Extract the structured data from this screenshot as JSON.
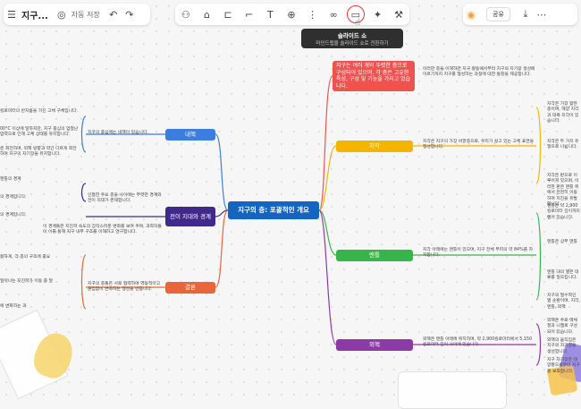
{
  "app": {
    "title": "지구...",
    "save_status": "자동 저장",
    "share_label": "공유"
  },
  "toolbar": {
    "center_icons": [
      "sticker-icon",
      "clip-icon",
      "subtopic-icon",
      "format-painter-icon",
      "text-icon",
      "insert-icon",
      "branch-icon",
      "link-icon",
      "slideshow-icon",
      "sparkle-icon",
      "magic-wand-icon"
    ]
  },
  "tooltip": {
    "title": "슬라이드 쇼",
    "desc": "마인드맵을 슬라이드 쇼로 전환하기"
  },
  "mindmap": {
    "root": "지구의 층: 포괄적인 개요",
    "left_nodes": {
      "inner": "내핵",
      "transition": "전이 지대와 경계",
      "crust": "결론"
    },
    "right_nodes": {
      "summary": "지구는 여러 개의 뚜렷한 층으로 구성되어 있으며, 각 층은 고유한 특성, 구성 및 기능을 가지고 있습니다.",
      "core_label": "지각",
      "mantle_label": "맨틀",
      "outer_label": "외핵"
    },
    "texts": {
      "summary_note": "이러한 층을 이해하면 지구 활동에서부터 지구의 자기장 생성에 이르기까지 지구를 형성하는 과정에 대한 통찰을 제공합니다.",
      "crust_note": "지각은 지구의 가장 바깥층으로, 우리가 살고 있는 고체 표면을 형성합니다.",
      "mantle_note": "지각 아래에는 맨틀이 있으며, 지구 전체 부피의 약 84%를 차지합니다.",
      "outer_note": "외핵은 맨틀 아래에 위치하며, 약 2,900킬로미터에서 5,150킬로미터 깊이 사이에 있습니다.",
      "inner_note": "지구의 중심에는 내핵이 있습니다.",
      "transition_note": "인접한 주요 층을 사이에는 뚜렷한 경계와 전이 지대가 존재합니다.",
      "transition_note2": "이 경계들은 지진파 속도의 갑작스러운 변화를 보여 주며, 과학자들이 이를 통해 지구 내부 구조를 이해하고 연구합니다.",
      "conclusion_note": "지구의 층들은 서로 협력하여 역동적이고 끊임없이 변화하는 행성을 만듭니다.",
      "far_left_1": "킬로미터의 반지름을 가진 고체 구체입니다.",
      "far_left_2": "00°C 이상에 달하지만, 지구 중심의 엄청난 압력으로 인해 고체 상태를 유지합니다.",
      "far_left_3": "운 회전하며, 외핵 방향과 약간 다르게 회전하며 지구의 자기장을 유지합니다.",
      "far_left_4": "맨틀의 경계",
      "far_left_5": "의 경계입니다.",
      "far_left_6": "의 경계입니다.",
      "far_left_7": "활하게, 각 층의 구조에 중요",
      "far_left_8": "일어나는 지진파가 이동 중 달",
      "far_left_9": "에 변화하는 과",
      "far_right_1": "지각은 가장 얇은 층이며, 해양 지각과 대륙 지각이 있습니다.",
      "far_right_2": "지각은 두 가지 유형으로 나뉩니다.",
      "far_right_3": "지각은 판으로 이루어져 있으며, 이러한 판은 맨틀 위에서 천천히 이동하여 지진을 유발합니다.",
      "far_right_4": "맨틀은 약 2,900 킬로미터 깊이까지 뻗어 있습니다.",
      "far_right_5": "맨틀은 상부 맨틀",
      "far_right_6": "맨틀 내의 열은 대류를 일으킵니다.",
      "far_right_7": "지구의 필수적인 열 순환이며, 지각, 맨틀, 외핵",
      "far_right_8": "외핵은 주로 액체 철과 니켈로 구성되어 있습니다.",
      "far_right_9": "외핵의 움직임은 지구의 자기장을 생성합니다.",
      "far_right_10": "지구 자기장은 태양풍으로부터 지구를 보호합니다."
    }
  }
}
